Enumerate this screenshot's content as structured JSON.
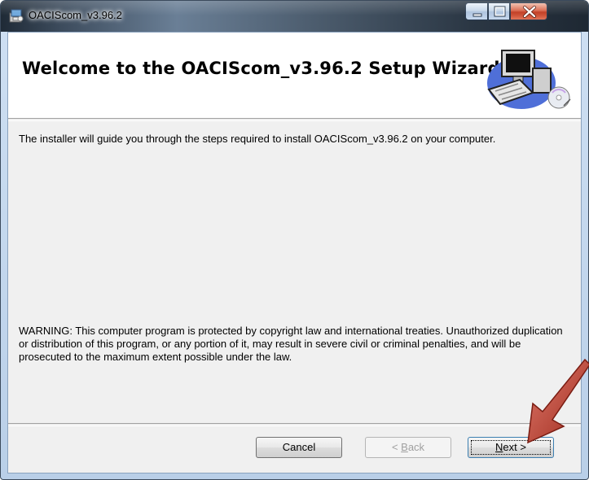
{
  "window": {
    "title": "OACIScom_v3.96.2"
  },
  "banner": {
    "title": "Welcome to the OACIScom_v3.96.2 Setup Wizard",
    "graphic": "computer-setup-graphic"
  },
  "body": {
    "intro": "The installer will guide you through the steps required to install OACIScom_v3.96.2 on your computer.",
    "warning": "WARNING: This computer program is protected by copyright law and international treaties. Unauthorized duplication or distribution of this program, or any portion of it, may result in severe civil or criminal penalties, and will be prosecuted to the maximum extent possible under the law."
  },
  "buttons": {
    "cancel": "Cancel",
    "back_prefix": "< ",
    "back_key": "B",
    "back_rest": "ack",
    "next_key": "N",
    "next_rest": "ext >"
  },
  "icons": {
    "title_icon": "installer-icon",
    "minimize": "minimize-icon",
    "maximize": "maximize-icon",
    "close": "close-icon",
    "annotation": "red-arrow-annotation"
  },
  "colors": {
    "arrow": "#c0392b",
    "close_button": "#c0391f"
  }
}
